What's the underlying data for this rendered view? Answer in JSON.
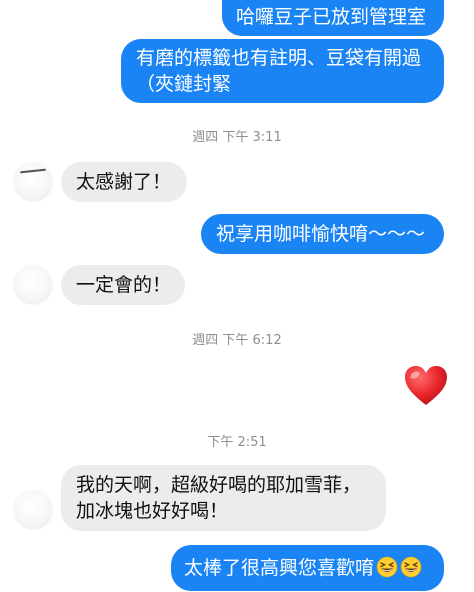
{
  "messages": {
    "m1": "哈囉豆子已放到管理室",
    "m2_line1": "有磨的標籤也有註明、豆袋有開過",
    "m2_line2": "（夾鏈封緊",
    "t1": "週四 下午 3:11",
    "m3": "太感謝了！",
    "m4": "祝享用咖啡愉快唷～～～",
    "m5": "一定會的！",
    "t2": "週四 下午 6:12",
    "t3": "下午 2:51",
    "m6_line1": "我的天啊，超級好喝的耶加雪菲，",
    "m6_line2": "加冰塊也好好喝！",
    "m7": "太棒了很高興您喜歡唷"
  },
  "icons": {
    "heart": "red-heart-emoji",
    "grin": "grinning-squinting-face-emoji"
  },
  "colors": {
    "sent_bubble": "#1a84f5",
    "received_bubble": "#ececed",
    "timestamp": "#8e8e93",
    "heart": "#e8262b"
  }
}
